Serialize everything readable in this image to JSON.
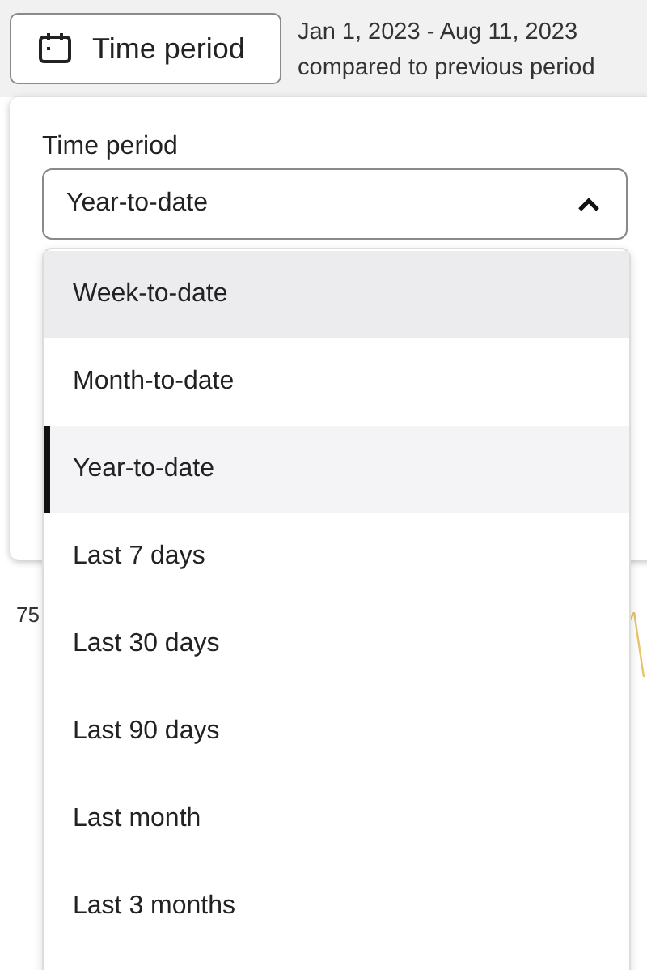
{
  "toolbar": {
    "button": {
      "label": "Time period"
    },
    "range": "Jan 1, 2023 - Aug 11, 2023",
    "comparison": "compared to previous period"
  },
  "background": {
    "fragments": [
      "75"
    ]
  },
  "popover": {
    "label": "Time period",
    "select": {
      "value": "Year-to-date",
      "expanded": true
    },
    "options": [
      {
        "label": "Week-to-date",
        "selected": false,
        "hovered": true
      },
      {
        "label": "Month-to-date",
        "selected": false,
        "hovered": false
      },
      {
        "label": "Year-to-date",
        "selected": true,
        "hovered": false
      },
      {
        "label": "Last 7 days",
        "selected": false,
        "hovered": false
      },
      {
        "label": "Last 30 days",
        "selected": false,
        "hovered": false
      },
      {
        "label": "Last 90 days",
        "selected": false,
        "hovered": false
      },
      {
        "label": "Last month",
        "selected": false,
        "hovered": false
      },
      {
        "label": "Last 3 months",
        "selected": false,
        "hovered": false
      }
    ]
  }
}
